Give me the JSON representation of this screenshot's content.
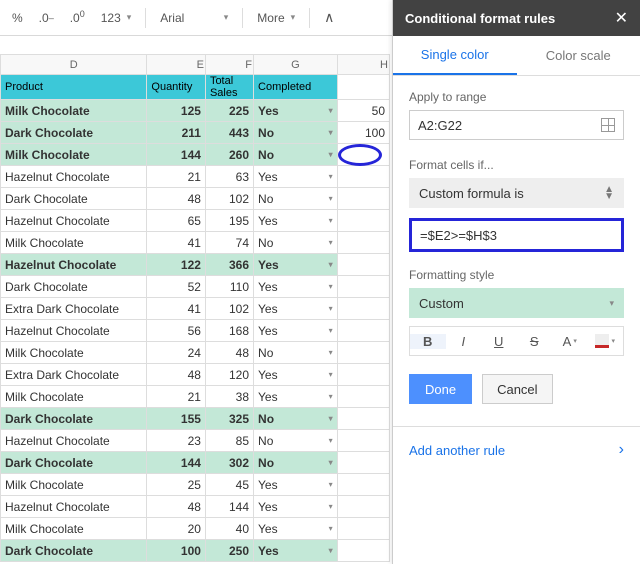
{
  "toolbar": {
    "percent": "%",
    "dec0": ".0",
    "dec00": ".00",
    "num123": "123",
    "font": "Arial",
    "more": "More",
    "collapse": "∧"
  },
  "columns": [
    "D",
    "E",
    "F",
    "G",
    "H"
  ],
  "headers": {
    "product": "Product",
    "quantity": "Quantity",
    "total_sales": "Total\nSales",
    "completed": "Completed"
  },
  "h_values": {
    "r1": "50",
    "r2": "100"
  },
  "rows": [
    {
      "p": "Milk Chocolate",
      "q": "125",
      "t": "225",
      "c": "Yes",
      "hl": true
    },
    {
      "p": "Dark Chocolate",
      "q": "211",
      "t": "443",
      "c": "No",
      "hl": true
    },
    {
      "p": "Milk Chocolate",
      "q": "144",
      "t": "260",
      "c": "No",
      "hl": true
    },
    {
      "p": "Hazelnut Chocolate",
      "q": "21",
      "t": "63",
      "c": "Yes",
      "hl": false
    },
    {
      "p": "Dark Chocolate",
      "q": "48",
      "t": "102",
      "c": "No",
      "hl": false
    },
    {
      "p": "Hazelnut Chocolate",
      "q": "65",
      "t": "195",
      "c": "Yes",
      "hl": false
    },
    {
      "p": "Milk Chocolate",
      "q": "41",
      "t": "74",
      "c": "No",
      "hl": false
    },
    {
      "p": "Hazelnut Chocolate",
      "q": "122",
      "t": "366",
      "c": "Yes",
      "hl": true
    },
    {
      "p": "Dark Chocolate",
      "q": "52",
      "t": "110",
      "c": "Yes",
      "hl": false
    },
    {
      "p": "Extra Dark Chocolate",
      "q": "41",
      "t": "102",
      "c": "Yes",
      "hl": false
    },
    {
      "p": "Hazelnut Chocolate",
      "q": "56",
      "t": "168",
      "c": "Yes",
      "hl": false
    },
    {
      "p": "Milk Chocolate",
      "q": "24",
      "t": "48",
      "c": "No",
      "hl": false
    },
    {
      "p": "Extra Dark Chocolate",
      "q": "48",
      "t": "120",
      "c": "Yes",
      "hl": false
    },
    {
      "p": "Milk Chocolate",
      "q": "21",
      "t": "38",
      "c": "Yes",
      "hl": false
    },
    {
      "p": "Dark Chocolate",
      "q": "155",
      "t": "325",
      "c": "No",
      "hl": true
    },
    {
      "p": "Hazelnut Chocolate",
      "q": "23",
      "t": "85",
      "c": "No",
      "hl": false
    },
    {
      "p": "Dark Chocolate",
      "q": "144",
      "t": "302",
      "c": "No",
      "hl": true
    },
    {
      "p": "Milk Chocolate",
      "q": "25",
      "t": "45",
      "c": "Yes",
      "hl": false
    },
    {
      "p": "Hazelnut Chocolate",
      "q": "48",
      "t": "144",
      "c": "Yes",
      "hl": false
    },
    {
      "p": "Milk Chocolate",
      "q": "20",
      "t": "40",
      "c": "Yes",
      "hl": false
    },
    {
      "p": "Dark Chocolate",
      "q": "100",
      "t": "250",
      "c": "Yes",
      "hl": true
    }
  ],
  "panel": {
    "title": "Conditional format rules",
    "tab_single": "Single color",
    "tab_scale": "Color scale",
    "apply_label": "Apply to range",
    "range": "A2:G22",
    "cond_label": "Format cells if...",
    "cond_value": "Custom formula is",
    "formula": "=$E2>=$H$3",
    "style_label": "Formatting style",
    "style_value": "Custom",
    "done": "Done",
    "cancel": "Cancel",
    "add_rule": "Add another rule"
  }
}
